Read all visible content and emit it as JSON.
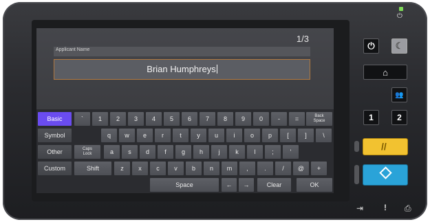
{
  "screen": {
    "page_indicator": "1/3",
    "field_label": "Applicant Name",
    "field_value": "Brian Humphreys"
  },
  "keyboard": {
    "modes": [
      "Basic",
      "Symbol",
      "Other",
      "Custom"
    ],
    "active_mode": "Basic",
    "row1": [
      "`",
      "1",
      "2",
      "3",
      "4",
      "5",
      "6",
      "7",
      "8",
      "9",
      "0",
      "-",
      "="
    ],
    "backspace": "Back Space",
    "row2": [
      "q",
      "w",
      "e",
      "r",
      "t",
      "y",
      "u",
      "i",
      "o",
      "p",
      "[",
      "]",
      "\\"
    ],
    "caps_lock": "Caps Lock",
    "row3": [
      "a",
      "s",
      "d",
      "f",
      "g",
      "h",
      "j",
      "k",
      "l",
      ";",
      "'"
    ],
    "shift": "Shift",
    "row4": [
      "z",
      "x",
      "c",
      "v",
      "b",
      "n",
      "m",
      ",",
      ".",
      "/",
      "@",
      "+"
    ],
    "space": "Space",
    "left_arrow": "←",
    "right_arrow": "→",
    "clear": "Clear",
    "ok": "OK"
  },
  "hardware": {
    "energy_key_1": "1",
    "energy_key_2": "2",
    "status_led_color": "#7ed957",
    "stop_color": "#f2c230",
    "start_color": "#2aa3d8"
  }
}
